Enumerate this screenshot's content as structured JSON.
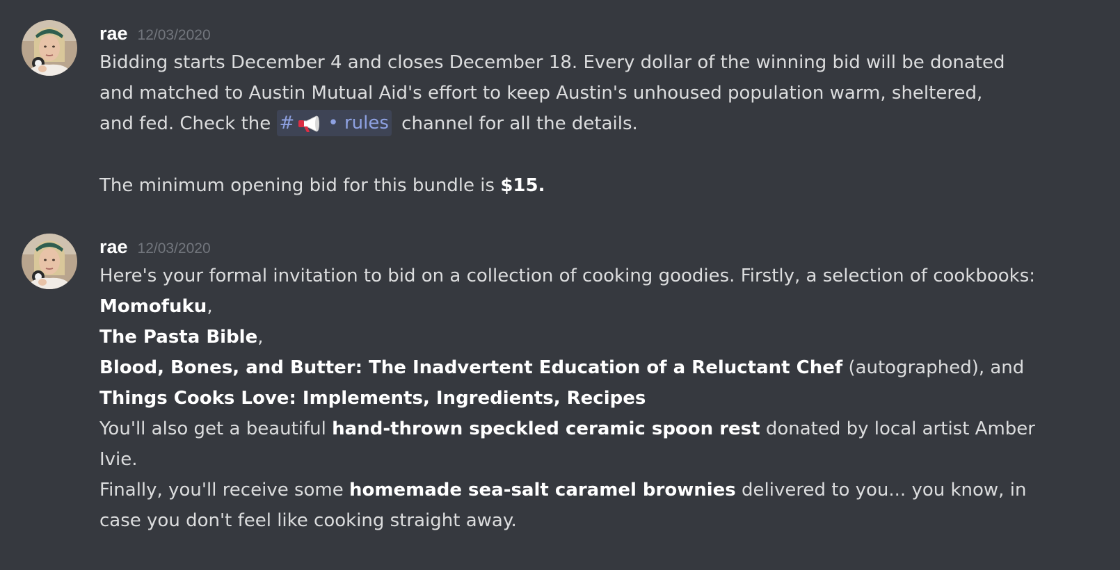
{
  "colors": {
    "background": "#36393f",
    "username": "#ffffff",
    "timestamp": "#72767d",
    "text": "#dcddde",
    "mention_text": "#8ea1e1"
  },
  "messages": [
    {
      "author": "rae",
      "timestamp": "12/03/2020",
      "avatar_icon": "user-avatar",
      "line1": "Bidding starts December 4 and closes December 18. Every dollar of the winning bid will be donated",
      "line2": "and matched to Austin Mutual Aid's effort to keep Austin's unhoused population warm, sheltered,",
      "line3_prefix": "and fed. Check the",
      "mention": {
        "hash": "#",
        "icon": "megaphone-icon",
        "name": "• rules"
      },
      "line3_suffix": "channel for all the details.",
      "line4_prefix": "The minimum opening bid for this bundle is",
      "line4_bold": "$15."
    },
    {
      "author": "rae",
      "timestamp": "12/03/2020",
      "avatar_icon": "user-avatar",
      "intro": "Here's your formal invitation to bid on a collection of cooking goodies. Firstly, a selection of cookbooks:",
      "book1": "Momofuku",
      "book1_suffix": ",",
      "book2": "The Pasta Bible",
      "book2_suffix": ",",
      "book3": "Blood, Bones, and Butter: The Inadvertent Education of a Reluctant Chef",
      "book3_suffix": "(autographed), and",
      "book4": "Things Cooks Love: Implements, Ingredients, Recipes",
      "spoon_prefix": "You'll also get a beautiful",
      "spoon_bold": "hand-thrown speckled ceramic spoon rest",
      "spoon_suffix": "donated by local artist Amber",
      "spoon_line2": "Ivie.",
      "brownie_prefix": "Finally, you'll receive some",
      "brownie_bold": "homemade sea-salt caramel brownies",
      "brownie_suffix": "delivered to you... you know, in",
      "brownie_line2": "case you don't feel like cooking straight away."
    }
  ]
}
